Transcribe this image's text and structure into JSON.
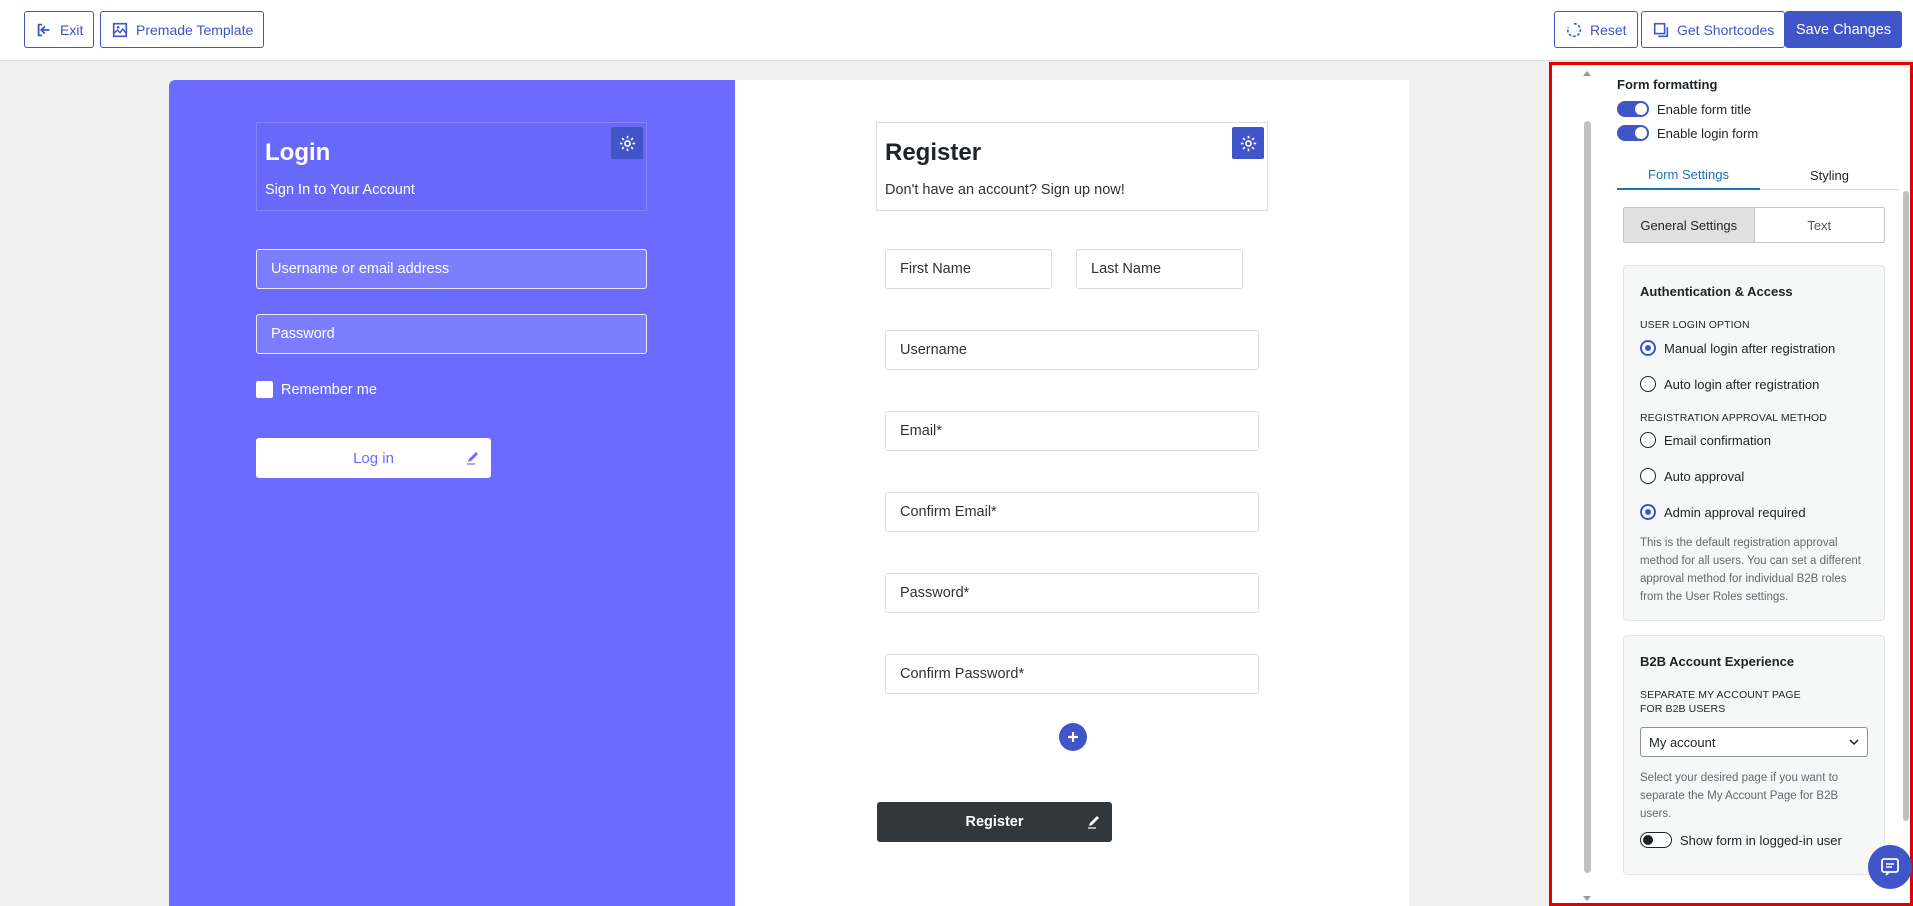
{
  "toolbar": {
    "exit_label": "Exit",
    "template_label": "Premade Template",
    "reset_label": "Reset",
    "shortcodes_label": "Get Shortcodes",
    "save_label": "Save Changes"
  },
  "login": {
    "title": "Login",
    "subtitle": "Sign In to Your Account",
    "username_placeholder": "Username or email address",
    "password_placeholder": "Password",
    "remember_label": "Remember me",
    "button_label": "Log in"
  },
  "register": {
    "title": "Register",
    "subtitle": "Don't have an account? Sign up now!",
    "first_name": "First Name",
    "last_name": "Last Name",
    "username": "Username",
    "email": "Email*",
    "confirm_email": "Confirm Email*",
    "password": "Password*",
    "confirm_password": "Confirm Password*",
    "button_label": "Register"
  },
  "sidebar": {
    "formatting_title": "Form formatting",
    "enable_title_label": "Enable form title",
    "enable_login_label": "Enable login form",
    "tabs": [
      "Form Settings",
      "Styling"
    ],
    "segments": [
      "General Settings",
      "Text"
    ],
    "auth": {
      "title": "Authentication & Access",
      "login_option_caption": "USER LOGIN OPTION",
      "login_options": [
        "Manual login after registration",
        "Auto login after registration"
      ],
      "approval_caption": "REGISTRATION APPROVAL METHOD",
      "approval_options": [
        "Email confirmation",
        "Auto approval",
        "Admin approval required"
      ],
      "help": "This is the default registration approval method for all users. You can set a different approval method for individual B2B roles from the User Roles settings."
    },
    "b2b": {
      "title": "B2B Account Experience",
      "caption": "SEPARATE MY ACCOUNT PAGE FOR B2B USERS",
      "select_value": "My account",
      "help": "Select your desired page if you want to separate the My Account Page for B2B users.",
      "show_form_label": "Show form in logged-in user"
    }
  },
  "colors": {
    "primary": "#3f55c8",
    "login_bg": "#6b6cff",
    "register_button": "#32373c",
    "highlight_border": "#e00000"
  }
}
